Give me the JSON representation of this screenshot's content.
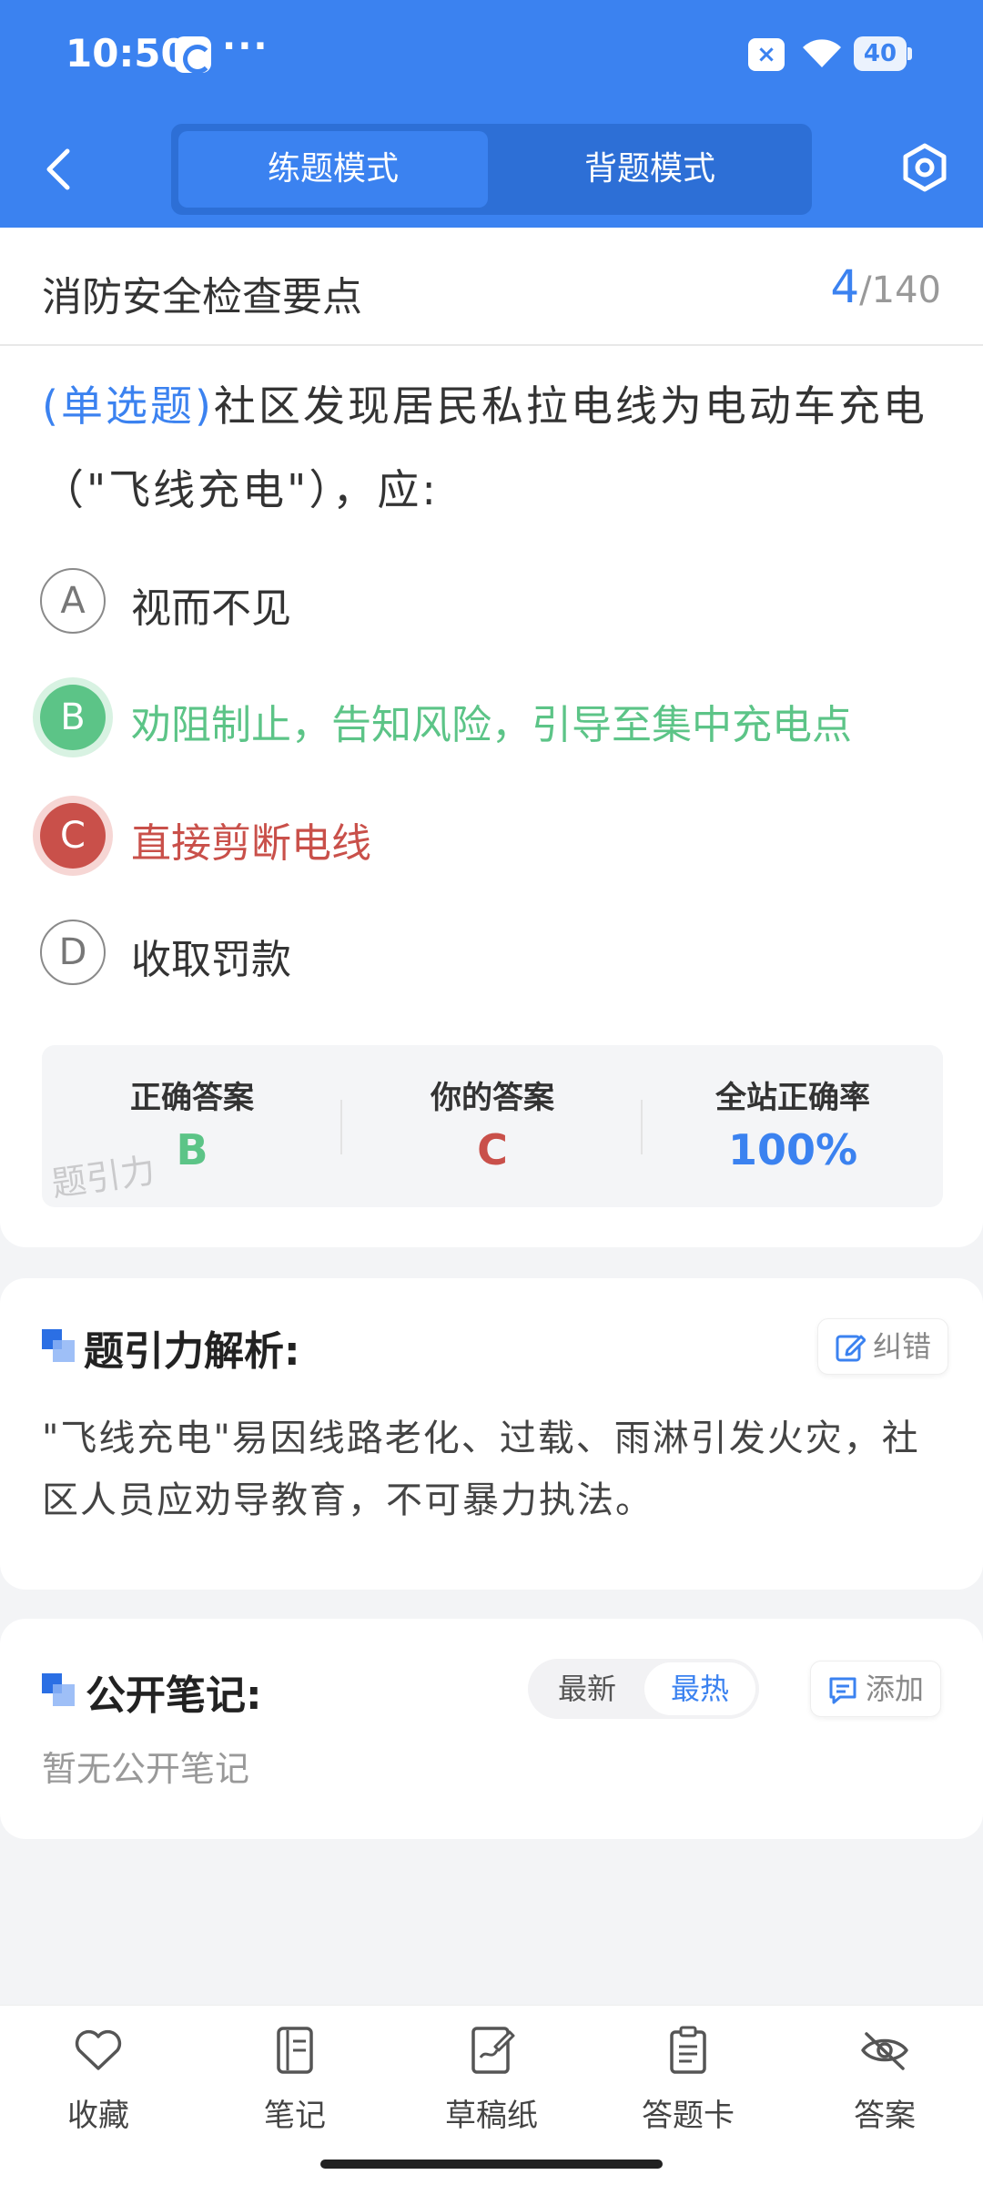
{
  "status_bar": {
    "time": "10:50",
    "battery": "40"
  },
  "header": {
    "tabs": [
      {
        "label": "练题模式",
        "active": true
      },
      {
        "label": "背题模式",
        "active": false
      }
    ]
  },
  "section": {
    "title": "消防安全检查要点",
    "current": "4",
    "separator": "/",
    "total": "140"
  },
  "question": {
    "type": "(单选题)",
    "text": "社区发现居民私拉电线为电动车充电（\"飞线充电\"），应:"
  },
  "options": [
    {
      "letter": "A",
      "text": "视而不见",
      "state": "normal"
    },
    {
      "letter": "B",
      "text": "劝阻制止，告知风险，引导至集中充电点",
      "state": "correct"
    },
    {
      "letter": "C",
      "text": "直接剪断电线",
      "state": "wrong"
    },
    {
      "letter": "D",
      "text": "收取罚款",
      "state": "normal"
    }
  ],
  "answer_summary": {
    "correct_label": "正确答案",
    "correct_value": "B",
    "yours_label": "你的答案",
    "yours_value": "C",
    "rate_label": "全站正确率",
    "rate_value": "100%",
    "watermark": "题引力"
  },
  "analysis": {
    "title": "题引力解析:",
    "report_label": "纠错",
    "text": "\"飞线充电\"易因线路老化、过载、雨淋引发火灾，社区人员应劝导教育，不可暴力执法。"
  },
  "notes": {
    "title": "公开笔记:",
    "sort_new": "最新",
    "sort_hot": "最热",
    "add_label": "添加",
    "empty": "暂无公开笔记"
  },
  "bottom_tabs": [
    {
      "label": "收藏",
      "icon": "heart-icon"
    },
    {
      "label": "笔记",
      "icon": "notebook-icon"
    },
    {
      "label": "草稿纸",
      "icon": "draft-icon"
    },
    {
      "label": "答题卡",
      "icon": "clipboard-icon"
    },
    {
      "label": "答案",
      "icon": "eye-off-icon"
    }
  ],
  "colors": {
    "primary": "#3b82f0",
    "correct": "#5cc487",
    "wrong": "#c9504a"
  }
}
